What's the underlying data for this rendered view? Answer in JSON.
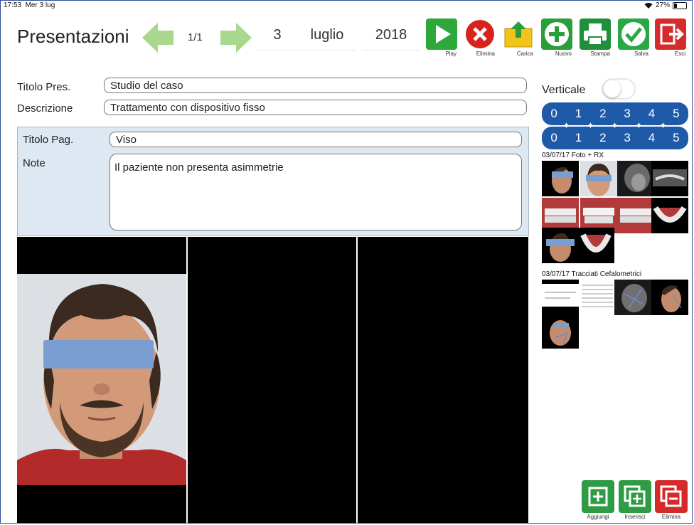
{
  "status": {
    "time": "17:53",
    "date": "Mer 3 lug",
    "battery": "27%",
    "battery_level": 0.27
  },
  "header": {
    "title": "Presentazioni",
    "pager": "1/1",
    "day": "3",
    "month": "luglio",
    "year": "2018"
  },
  "toolbar": [
    {
      "id": "play",
      "label": "Play",
      "color": "#2fa83a",
      "icon": "play-icon"
    },
    {
      "id": "elimina",
      "label": "Elimina",
      "color": "#d8231d",
      "icon": "x-icon"
    },
    {
      "id": "carica",
      "label": "Carica",
      "color": "#f0c419",
      "icon": "upload-folder-icon"
    },
    {
      "id": "nuovo",
      "label": "Nuovo",
      "color": "#2b9e3c",
      "icon": "plus-icon"
    },
    {
      "id": "stampa",
      "label": "Stampa",
      "color": "#1f8f3a",
      "icon": "printer-icon"
    },
    {
      "id": "salva",
      "label": "Salva",
      "color": "#2aa844",
      "icon": "check-icon"
    },
    {
      "id": "esci",
      "label": "Esci",
      "color": "#d62b2b",
      "icon": "exit-icon"
    }
  ],
  "form": {
    "title_label": "Titolo Pres.",
    "title_value": "Studio del caso",
    "desc_label": "Descrizione",
    "desc_value": "Trattamento con dispositivo fisso",
    "page_title_label": "Titolo Pag.",
    "page_title_value": "Viso",
    "notes_label": "Note",
    "notes_value": "Il paziente non presenta asimmetrie"
  },
  "sidebar": {
    "vertical_label": "Verticale",
    "vertical_on": false,
    "row1": [
      "0",
      "1",
      "2",
      "3",
      "4",
      "5"
    ],
    "row2": [
      "0",
      "1",
      "2",
      "3",
      "4",
      "5"
    ],
    "group1_title": "03/07/17 Foto + RX",
    "group2_title": "03/07/17 Tracciati Cefalometrici"
  },
  "bottom_buttons": [
    {
      "id": "aggiungi",
      "label": "Aggiungi",
      "color": "#2f9b45",
      "icon": "add-icon"
    },
    {
      "id": "inserisci",
      "label": "Inserisci",
      "color": "#2f9b45",
      "icon": "insert-icon"
    },
    {
      "id": "elimina",
      "label": "Elimina",
      "color": "#d52a2a",
      "icon": "delete-icon"
    }
  ],
  "colors": {
    "accent": "#1f5aa8",
    "panel": "#dde8f3",
    "border": "#2c4c9c"
  }
}
